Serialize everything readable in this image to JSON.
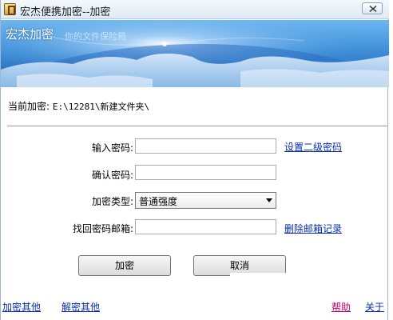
{
  "window": {
    "title": "宏杰便携加密--加密",
    "close_label": "close"
  },
  "banner": {
    "title": "宏杰加密",
    "subtitle": "你的文件保险箱"
  },
  "current": {
    "label": "当前加密:",
    "path": "E:\\12281\\新建文件夹\\"
  },
  "form": {
    "password_label": "输入密码:",
    "password_value": "",
    "confirm_label": "确认密码:",
    "confirm_value": "",
    "type_label": "加密类型:",
    "type_selected": "普通强度",
    "email_label": "找回密码邮箱:",
    "email_value": "",
    "set_secondary_link": "设置二级密码",
    "delete_email_link": "删除邮箱记录"
  },
  "buttons": {
    "encrypt": "加密",
    "cancel": "取消"
  },
  "footer": {
    "encrypt_other": "加密其他",
    "decrypt_other": "解密其他",
    "help": "帮助",
    "about": "关于"
  },
  "colors": {
    "link": "#0b2ea8",
    "help_link": "#c0006a",
    "banner_top": "#6db6f0",
    "banner_bottom": "#1f5fae"
  },
  "icons": {
    "app": "lock-app-icon",
    "close": "close-icon",
    "dropdown": "chevron-down-icon"
  }
}
